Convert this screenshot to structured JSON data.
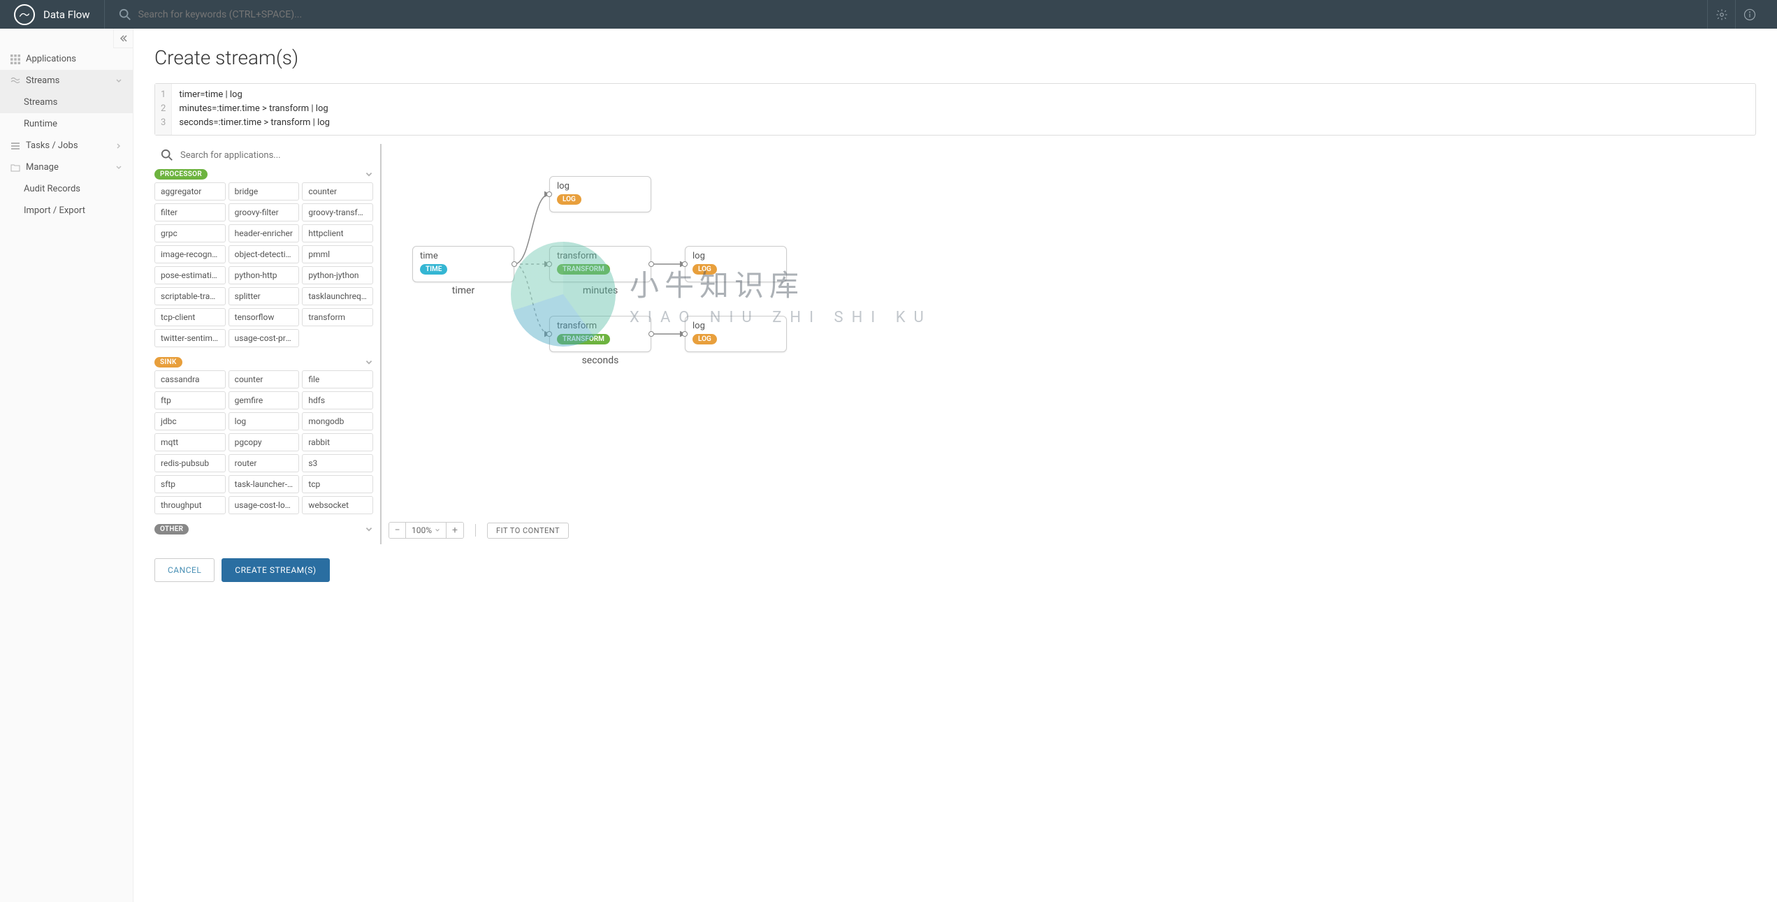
{
  "topbar": {
    "title": "Data Flow",
    "search_placeholder": "Search for keywords (CTRL+SPACE)..."
  },
  "sidebar": {
    "applications": "Applications",
    "streams": "Streams",
    "streams_sub": "Streams",
    "runtime": "Runtime",
    "tasks_jobs": "Tasks / Jobs",
    "manage": "Manage",
    "audit_records": "Audit Records",
    "import_export": "Import / Export"
  },
  "page": {
    "title": "Create stream(s)"
  },
  "code": {
    "lines": [
      "timer=time | log",
      "minutes=:timer.time > transform | log",
      "seconds=:timer.time > transform | log"
    ]
  },
  "palette": {
    "search_placeholder": "Search for applications...",
    "sections": {
      "processor": {
        "label": "PROCESSOR",
        "items": [
          "aggregator",
          "bridge",
          "counter",
          "filter",
          "groovy-filter",
          "groovy-transform",
          "grpc",
          "header-enricher",
          "httpclient",
          "image-recogniti…",
          "object-detection",
          "pmml",
          "pose-estimation",
          "python-http",
          "python-jython",
          "scriptable-transf…",
          "splitter",
          "tasklaunchreque…",
          "tcp-client",
          "tensorflow",
          "transform",
          "twitter-sentiment",
          "usage-cost-proc…"
        ]
      },
      "sink": {
        "label": "SINK",
        "items": [
          "cassandra",
          "counter",
          "file",
          "ftp",
          "gemfire",
          "hdfs",
          "jdbc",
          "log",
          "mongodb",
          "mqtt",
          "pgcopy",
          "rabbit",
          "redis-pubsub",
          "router",
          "s3",
          "sftp",
          "task-launcher-d…",
          "tcp",
          "throughput",
          "usage-cost-logg…",
          "websocket"
        ]
      },
      "other": {
        "label": "OTHER"
      }
    }
  },
  "canvas": {
    "zoom": "100%",
    "fit_label": "FIT TO CONTENT",
    "nodes": {
      "timer_log": {
        "title": "log",
        "badge": "LOG"
      },
      "time": {
        "title": "time",
        "badge": "TIME",
        "label": "timer"
      },
      "min_tr": {
        "title": "transform",
        "badge": "TRANSFORM",
        "label": "minutes"
      },
      "min_log": {
        "title": "log",
        "badge": "LOG"
      },
      "sec_tr": {
        "title": "transform",
        "badge": "TRANSFORM",
        "label": "seconds"
      },
      "sec_log": {
        "title": "log",
        "badge": "LOG"
      }
    }
  },
  "footer": {
    "cancel": "CANCEL",
    "create": "CREATE STREAM(S)"
  },
  "watermark": {
    "cn": "小牛知识库",
    "en": "XIAO NIU ZHI SHI KU"
  }
}
